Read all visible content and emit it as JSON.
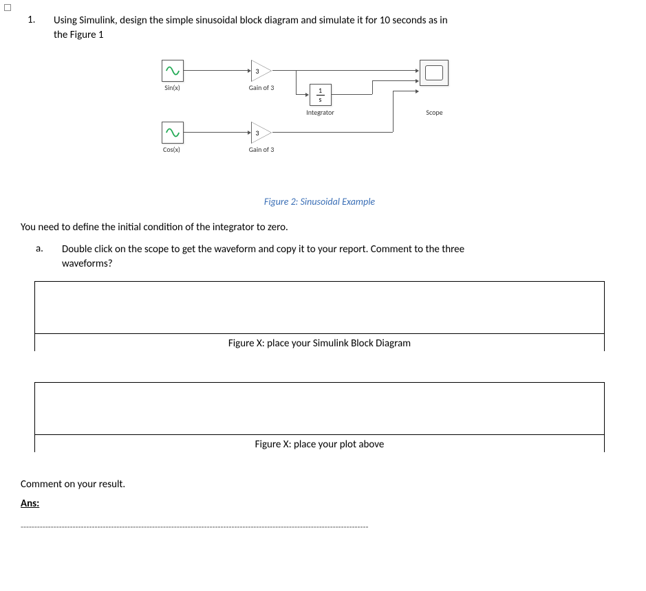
{
  "question": {
    "number": "1.",
    "text_line1": "Using Simulink, design the simple sinusoidal block diagram and simulate it for 10 seconds as in",
    "text_line2": "the Figure 1"
  },
  "diagram": {
    "blocks": {
      "sin": {
        "label": "Sin(x)"
      },
      "cos": {
        "label": "Cos(x)"
      },
      "gain1": {
        "value": "3",
        "label": "Gain of 3"
      },
      "gain2": {
        "value": "3",
        "label": "Gain of 3"
      },
      "integrator": {
        "num": "1",
        "den": "s",
        "label": "Integrator"
      },
      "scope": {
        "label": "Scope"
      }
    },
    "caption": "Figure 2: Sinusoidal Example"
  },
  "instruction": "You need to define the initial condition of the integrator to zero.",
  "subquestion": {
    "letter": "a.",
    "text_line1": "Double click on the scope to get the waveform and copy it to your report. Comment to the three",
    "text_line2": "waveforms?"
  },
  "placeholders": {
    "box1_caption": "Figure X: place your Simulink Block Diagram",
    "box2_caption": "Figure X: place your plot above"
  },
  "comment_prompt": "Comment on your result.",
  "answer_label": "Ans:",
  "dashes": "-------------------------------------------------------------------------------------------------------------------------------"
}
